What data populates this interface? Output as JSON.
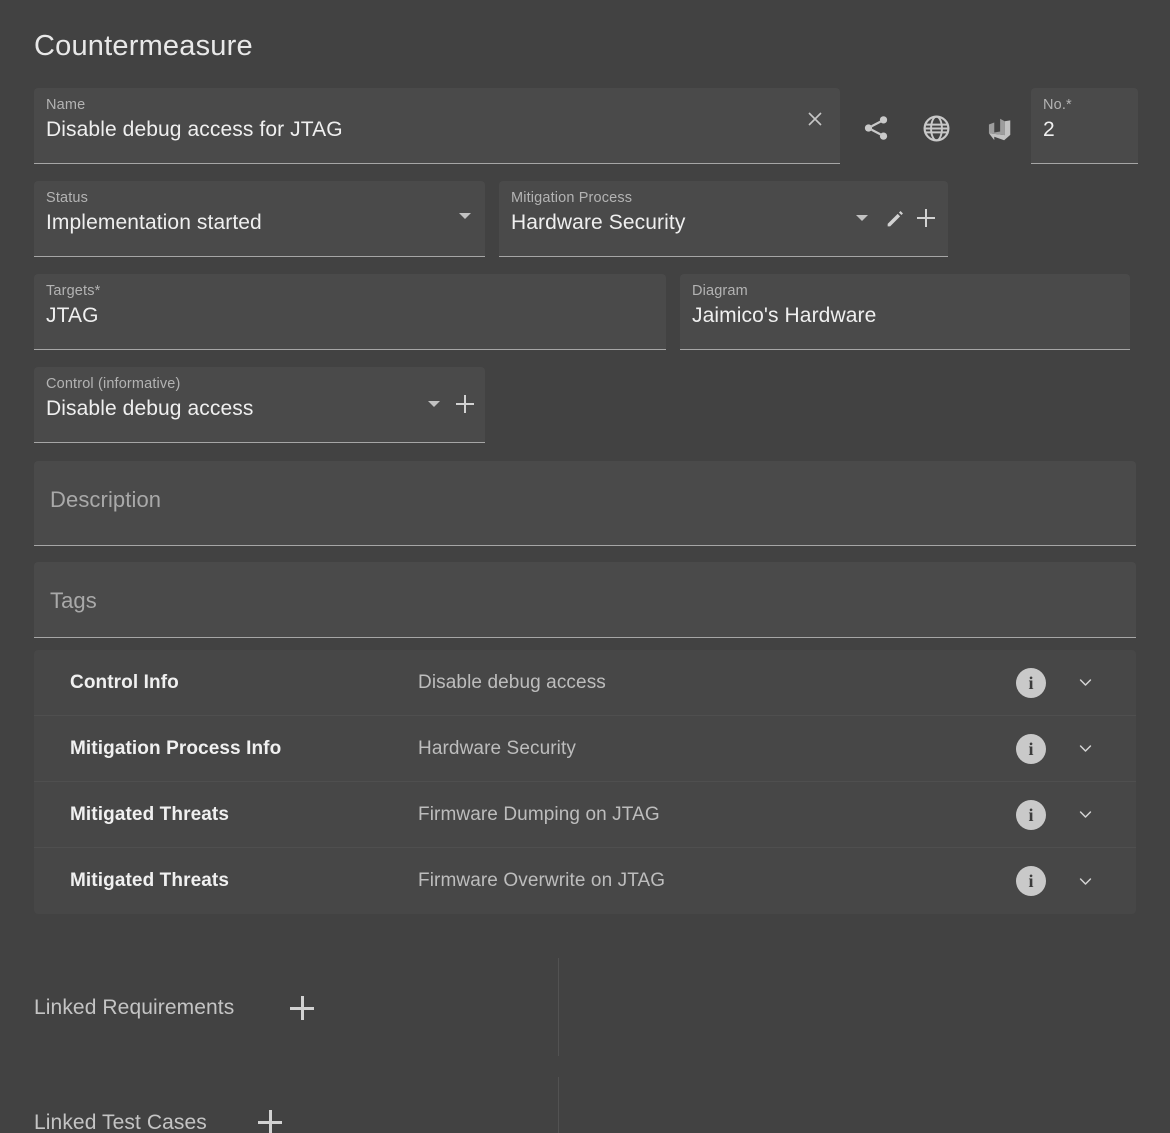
{
  "header": {
    "title": "Countermeasure"
  },
  "name_field": {
    "label": "Name",
    "value": "Disable debug access for JTAG",
    "clear_icon": "close-icon",
    "actions": [
      {
        "icon": "share-icon"
      },
      {
        "icon": "globe-icon"
      },
      {
        "icon": "azure-devops-icon"
      }
    ]
  },
  "number_field": {
    "label": "No.*",
    "value": "2"
  },
  "status_field": {
    "label": "Status",
    "value": "Implementation started"
  },
  "mitigation_process_field": {
    "label": "Mitigation Process",
    "value": "Hardware Security"
  },
  "targets_field": {
    "label": "Targets*",
    "value": "JTAG"
  },
  "diagram_field": {
    "label": "Diagram",
    "value": "Jaimico's Hardware"
  },
  "control_field": {
    "label": "Control (informative)",
    "value": "Disable debug access"
  },
  "description_field": {
    "placeholder": "Description",
    "value": ""
  },
  "tags_field": {
    "placeholder": "Tags",
    "value": ""
  },
  "info_rows": [
    {
      "key": "Control Info",
      "value": "Disable debug access",
      "info_icon": "info-icon",
      "expand_icon": "chevron-down-icon"
    },
    {
      "key": "Mitigation Process Info",
      "value": "Hardware Security",
      "info_icon": "info-icon",
      "expand_icon": "chevron-down-icon"
    },
    {
      "key": "Mitigated Threats",
      "value": "Firmware Dumping on JTAG",
      "info_icon": "info-icon",
      "expand_icon": "chevron-down-icon"
    },
    {
      "key": "Mitigated Threats",
      "value": "Firmware Overwrite on JTAG",
      "info_icon": "info-icon",
      "expand_icon": "chevron-down-icon"
    }
  ],
  "linked_sections": [
    {
      "title": "Linked Requirements",
      "add_icon": "plus-icon"
    },
    {
      "title": "Linked Test Cases",
      "add_icon": "plus-icon"
    }
  ],
  "colors": {
    "page_background": "#424242",
    "field_background": "#4a4a4a",
    "panel_background": "#474747",
    "underline": "#a6a6a6",
    "primary_text": "#efefef",
    "secondary_text": "#b3b3b3",
    "muted_text": "#bdbdbd",
    "info_badge": "#c9c9c9"
  }
}
